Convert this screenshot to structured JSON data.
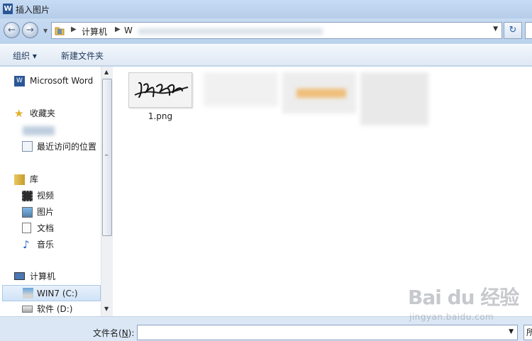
{
  "window": {
    "title": "插入图片",
    "app_icon": "W"
  },
  "navigation": {
    "back_icon": "back-icon",
    "forward_icon": "forward-icon"
  },
  "address": {
    "root": "计算机",
    "partial": "W",
    "refresh_icon": "refresh-icon"
  },
  "commands": {
    "organize": "组织 ▾",
    "new_folder": "新建文件夹"
  },
  "sidebar": {
    "word": "Microsoft Word",
    "favorites": "收藏夹",
    "recent": "最近访问的位置",
    "library": "库",
    "video": "视频",
    "pictures": "图片",
    "documents": "文档",
    "music": "音乐",
    "computer": "计算机",
    "win7": "WIN7 (C:)",
    "software": "软件 (D:)"
  },
  "files": [
    {
      "name": "1.png"
    }
  ],
  "bottom": {
    "file_name_label": "文件名(",
    "file_name_key": "N",
    "file_name_end": "):",
    "file_name_value": "",
    "filter_stub": "所"
  },
  "watermark": {
    "main": "Bai du 经验",
    "sub": "jingyan.baidu.com"
  },
  "colors": {
    "selection": "#d0e3f7",
    "word_blue": "#2b5797",
    "title_bar": "#c7dcf4"
  }
}
